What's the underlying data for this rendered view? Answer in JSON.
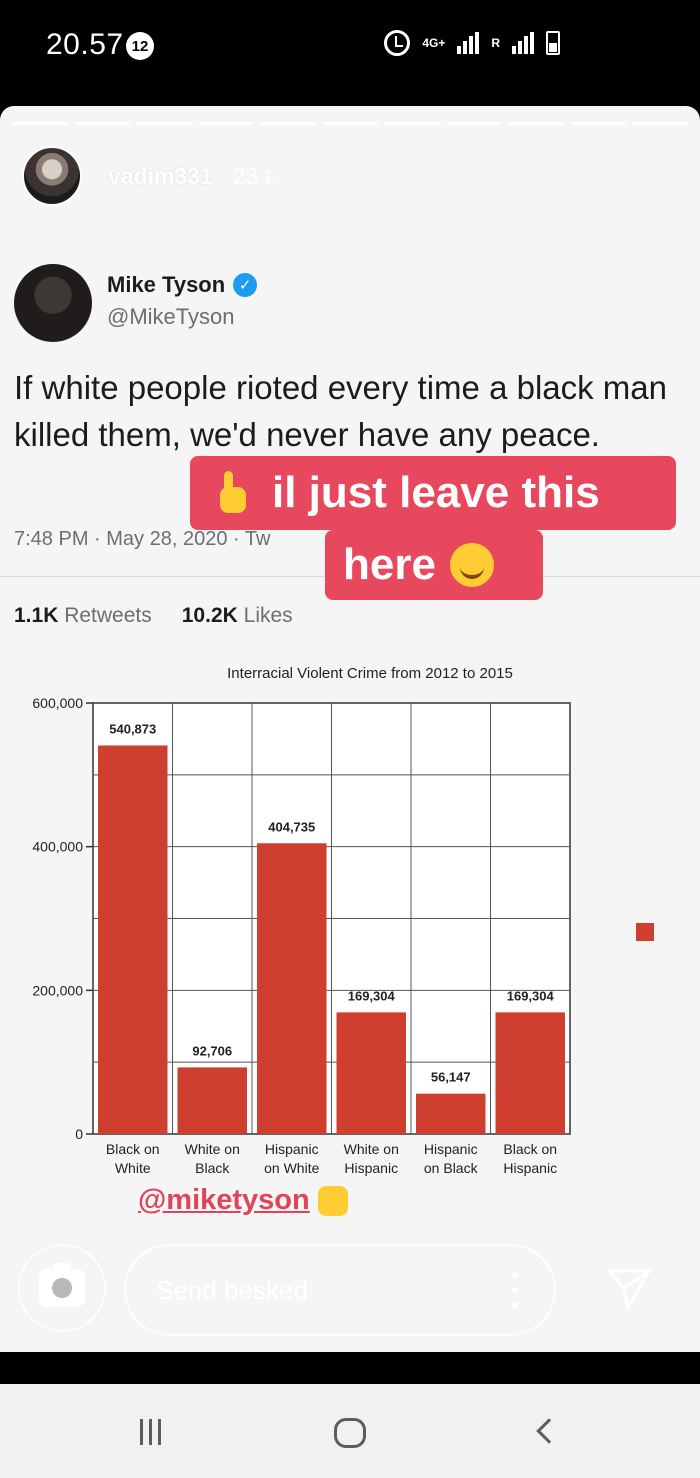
{
  "status_bar": {
    "time": "20.57",
    "notif_count": "12",
    "network": "4G+",
    "roaming": "R"
  },
  "story": {
    "username": "vadim331",
    "time_ago": "23 t.",
    "progress_segments": 11,
    "progress_current": 1,
    "caption_line1": "il just leave this",
    "caption_line2": "here",
    "mention": "@miketyson"
  },
  "tweet": {
    "name": "Mike Tyson",
    "handle": "@MikeTyson",
    "text": "If white people rioted every time a black man killed them, we'd never have any peace.",
    "meta": "7:48 PM · May 28, 2020 · Tw",
    "retweets_count": "1.1K",
    "retweets_label": "Retweets",
    "likes_count": "10.2K",
    "likes_label": "Likes"
  },
  "chart_data": {
    "type": "bar",
    "title": "Interracial Violent Crime from 2012 to 2015",
    "categories": [
      "Black on White",
      "White on Black",
      "Hispanic on White",
      "White on Hispanic",
      "Hispanic on Black",
      "Black on Hispanic"
    ],
    "category_lines": [
      [
        "Black on",
        "White"
      ],
      [
        "White on",
        "Black"
      ],
      [
        "Hispanic",
        "on White"
      ],
      [
        "White on",
        "Hispanic"
      ],
      [
        "Hispanic",
        "on Black"
      ],
      [
        "Black on",
        "Hispanic"
      ]
    ],
    "values": [
      540873,
      92706,
      404735,
      169304,
      56147,
      169304
    ],
    "value_labels": [
      "540,873",
      "92,706",
      "404,735",
      "169,304",
      "56,147",
      "169,304"
    ],
    "yticks": [
      0,
      200000,
      400000,
      600000
    ],
    "ytick_labels": [
      "0",
      "200,000",
      "400,000",
      "600,000"
    ],
    "ylim": [
      0,
      600000
    ],
    "bar_color": "#cf3f30",
    "grid": true
  },
  "reply": {
    "placeholder": "Send besked"
  },
  "colors": {
    "sticker": "#e8485e",
    "mention": "#e0445a",
    "bar": "#cf3f30"
  },
  "icons": [
    "alarm-icon",
    "signal-icon",
    "battery-icon",
    "verified-icon",
    "camera-icon",
    "more-icon",
    "send-icon",
    "nav-recent-icon",
    "nav-home-icon",
    "nav-back-icon"
  ]
}
